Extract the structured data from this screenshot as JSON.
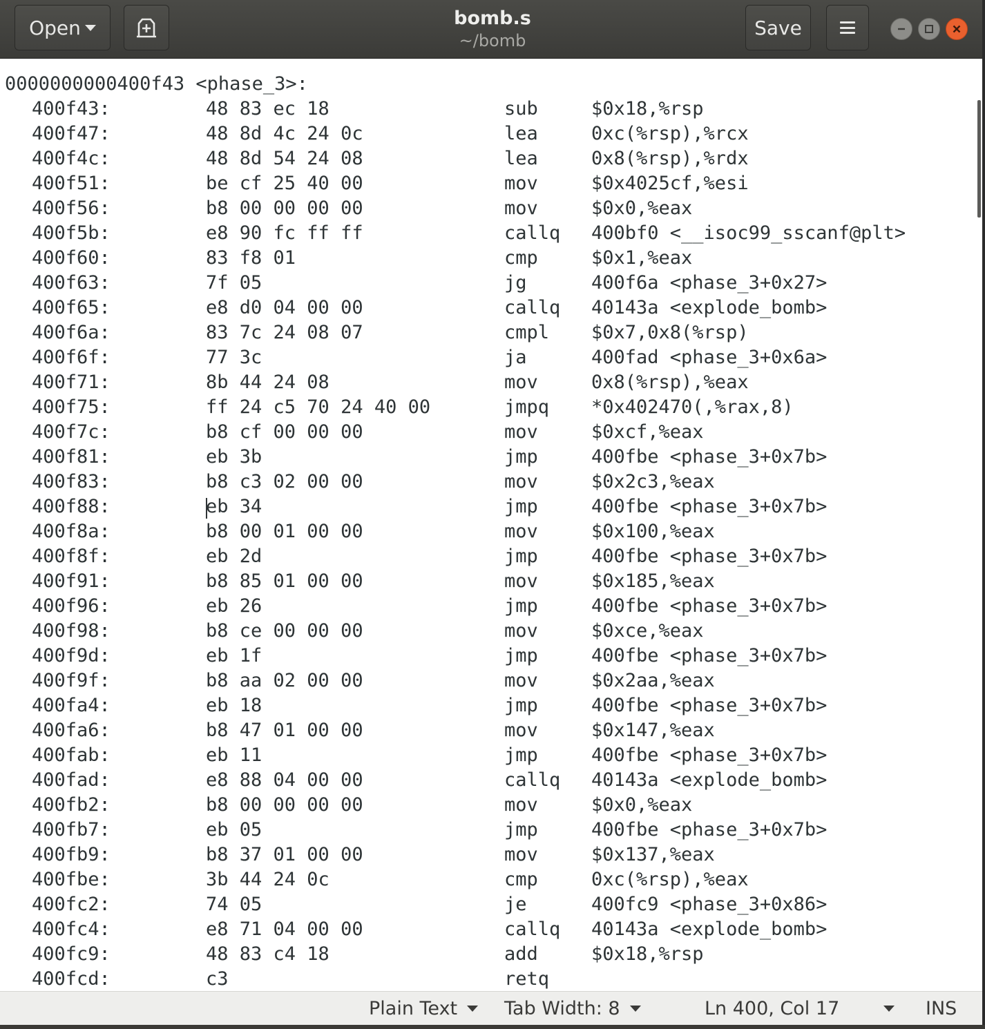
{
  "header": {
    "open_label": "Open",
    "save_label": "Save",
    "title": "bomb.s",
    "subtitle": "~/bomb"
  },
  "editor": {
    "heading": "0000000000400f43 <phase_3>:",
    "lines": [
      {
        "addr": "400f43:",
        "bytes": "48 83 ec 18",
        "op": "sub",
        "args": "$0x18,%rsp"
      },
      {
        "addr": "400f47:",
        "bytes": "48 8d 4c 24 0c",
        "op": "lea",
        "args": "0xc(%rsp),%rcx"
      },
      {
        "addr": "400f4c:",
        "bytes": "48 8d 54 24 08",
        "op": "lea",
        "args": "0x8(%rsp),%rdx"
      },
      {
        "addr": "400f51:",
        "bytes": "be cf 25 40 00",
        "op": "mov",
        "args": "$0x4025cf,%esi"
      },
      {
        "addr": "400f56:",
        "bytes": "b8 00 00 00 00",
        "op": "mov",
        "args": "$0x0,%eax"
      },
      {
        "addr": "400f5b:",
        "bytes": "e8 90 fc ff ff",
        "op": "callq",
        "args": "400bf0 <__isoc99_sscanf@plt>"
      },
      {
        "addr": "400f60:",
        "bytes": "83 f8 01",
        "op": "cmp",
        "args": "$0x1,%eax"
      },
      {
        "addr": "400f63:",
        "bytes": "7f 05",
        "op": "jg",
        "args": "400f6a <phase_3+0x27>"
      },
      {
        "addr": "400f65:",
        "bytes": "e8 d0 04 00 00",
        "op": "callq",
        "args": "40143a <explode_bomb>"
      },
      {
        "addr": "400f6a:",
        "bytes": "83 7c 24 08 07",
        "op": "cmpl",
        "args": "$0x7,0x8(%rsp)"
      },
      {
        "addr": "400f6f:",
        "bytes": "77 3c",
        "op": "ja",
        "args": "400fad <phase_3+0x6a>"
      },
      {
        "addr": "400f71:",
        "bytes": "8b 44 24 08",
        "op": "mov",
        "args": "0x8(%rsp),%eax"
      },
      {
        "addr": "400f75:",
        "bytes": "ff 24 c5 70 24 40 00",
        "op": "jmpq",
        "args": "*0x402470(,%rax,8)"
      },
      {
        "addr": "400f7c:",
        "bytes": "b8 cf 00 00 00",
        "op": "mov",
        "args": "$0xcf,%eax"
      },
      {
        "addr": "400f81:",
        "bytes": "eb 3b",
        "op": "jmp",
        "args": "400fbe <phase_3+0x7b>"
      },
      {
        "addr": "400f83:",
        "bytes": "b8 c3 02 00 00",
        "op": "mov",
        "args": "$0x2c3,%eax"
      },
      {
        "addr": "400f88:",
        "bytes": "eb 34",
        "op": "jmp",
        "args": "400fbe <phase_3+0x7b>"
      },
      {
        "addr": "400f8a:",
        "bytes": "b8 00 01 00 00",
        "op": "mov",
        "args": "$0x100,%eax"
      },
      {
        "addr": "400f8f:",
        "bytes": "eb 2d",
        "op": "jmp",
        "args": "400fbe <phase_3+0x7b>"
      },
      {
        "addr": "400f91:",
        "bytes": "b8 85 01 00 00",
        "op": "mov",
        "args": "$0x185,%eax"
      },
      {
        "addr": "400f96:",
        "bytes": "eb 26",
        "op": "jmp",
        "args": "400fbe <phase_3+0x7b>"
      },
      {
        "addr": "400f98:",
        "bytes": "b8 ce 00 00 00",
        "op": "mov",
        "args": "$0xce,%eax"
      },
      {
        "addr": "400f9d:",
        "bytes": "eb 1f",
        "op": "jmp",
        "args": "400fbe <phase_3+0x7b>"
      },
      {
        "addr": "400f9f:",
        "bytes": "b8 aa 02 00 00",
        "op": "mov",
        "args": "$0x2aa,%eax"
      },
      {
        "addr": "400fa4:",
        "bytes": "eb 18",
        "op": "jmp",
        "args": "400fbe <phase_3+0x7b>"
      },
      {
        "addr": "400fa6:",
        "bytes": "b8 47 01 00 00",
        "op": "mov",
        "args": "$0x147,%eax"
      },
      {
        "addr": "400fab:",
        "bytes": "eb 11",
        "op": "jmp",
        "args": "400fbe <phase_3+0x7b>"
      },
      {
        "addr": "400fad:",
        "bytes": "e8 88 04 00 00",
        "op": "callq",
        "args": "40143a <explode_bomb>"
      },
      {
        "addr": "400fb2:",
        "bytes": "b8 00 00 00 00",
        "op": "mov",
        "args": "$0x0,%eax"
      },
      {
        "addr": "400fb7:",
        "bytes": "eb 05",
        "op": "jmp",
        "args": "400fbe <phase_3+0x7b>"
      },
      {
        "addr": "400fb9:",
        "bytes": "b8 37 01 00 00",
        "op": "mov",
        "args": "$0x137,%eax"
      },
      {
        "addr": "400fbe:",
        "bytes": "3b 44 24 0c",
        "op": "cmp",
        "args": "0xc(%rsp),%eax"
      },
      {
        "addr": "400fc2:",
        "bytes": "74 05",
        "op": "je",
        "args": "400fc9 <phase_3+0x86>"
      },
      {
        "addr": "400fc4:",
        "bytes": "e8 71 04 00 00",
        "op": "callq",
        "args": "40143a <explode_bomb>"
      },
      {
        "addr": "400fc9:",
        "bytes": "48 83 c4 18",
        "op": "add",
        "args": "$0x18,%rsp"
      },
      {
        "addr": "400fcd:",
        "bytes": "c3",
        "op": "retq",
        "args": ""
      }
    ]
  },
  "statusbar": {
    "language": "Plain Text",
    "tab_width": "Tab Width: 8",
    "position": "Ln 400, Col 17",
    "mode": "INS"
  }
}
